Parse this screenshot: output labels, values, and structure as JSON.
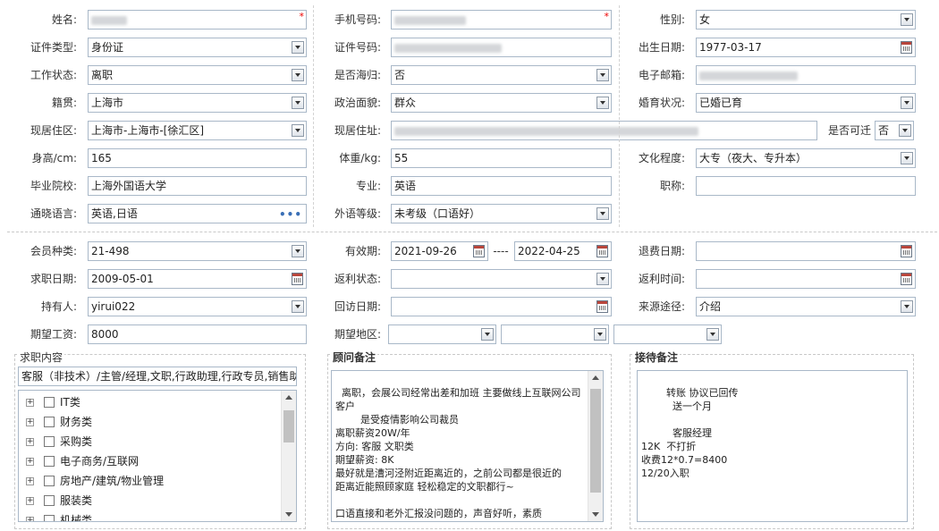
{
  "personal": {
    "name_label": "姓名:",
    "name_value": "",
    "phone_label": "手机号码:",
    "phone_value": "",
    "gender_label": "性别:",
    "gender_value": "女",
    "id_type_label": "证件类型:",
    "id_type_value": "身份证",
    "id_no_label": "证件号码:",
    "id_no_value": "",
    "birth_label": "出生日期:",
    "birth_value": "1977-03-17",
    "work_status_label": "工作状态:",
    "work_status_value": "离职",
    "overseas_label": "是否海归:",
    "overseas_value": "否",
    "email_label": "电子邮箱:",
    "email_value": "",
    "native_label": "籍贯:",
    "native_value": "上海市",
    "political_label": "政治面貌:",
    "political_value": "群众",
    "marital_label": "婚育状况:",
    "marital_value": "已婚已育",
    "district_label": "现居住区:",
    "district_value": "上海市-上海市-[徐汇区]",
    "address_label": "现居住址:",
    "address_value": "",
    "relocate_label": "是否可迁",
    "relocate_value": "否",
    "height_label": "身高/cm:",
    "height_value": "165",
    "weight_label": "体重/kg:",
    "weight_value": "55",
    "education_label": "文化程度:",
    "education_value": "大专（夜大、专升本）",
    "school_label": "毕业院校:",
    "school_value": "上海外国语大学",
    "major_label": "专业:",
    "major_value": "英语",
    "title_label": "职称:",
    "title_value": "",
    "language_label": "通晓语言:",
    "language_value": "英语,日语",
    "foreign_level_label": "外语等级:",
    "foreign_level_value": "未考级（口语好）"
  },
  "membership": {
    "type_label": "会员种类:",
    "type_value": "21-498",
    "valid_label": "有效期:",
    "valid_from": "2021-09-26",
    "valid_sep": "----",
    "valid_to": "2022-04-25",
    "refund_date_label": "退费日期:",
    "refund_date_value": "",
    "job_date_label": "求职日期:",
    "job_date_value": "2009-05-01",
    "rebate_status_label": "返利状态:",
    "rebate_status_value": "",
    "rebate_time_label": "返利时间:",
    "rebate_time_value": "",
    "holder_label": "持有人:",
    "holder_value": "yirui022",
    "visit_date_label": "回访日期:",
    "visit_date_value": "",
    "source_label": "来源途径:",
    "source_value": "介绍",
    "salary_label": "期望工资:",
    "salary_value": "8000",
    "region_label": "期望地区:",
    "region_values": [
      "",
      "",
      ""
    ]
  },
  "job_panel": {
    "title": "求职内容",
    "summary": "客服（非技术）/主管/经理,文职,行政助理,行政专员,销售助",
    "categories": [
      "IT类",
      "财务类",
      "采购类",
      "电子商务/互联网",
      "房地产/建筑/物业管理",
      "服装类",
      "机械类"
    ]
  },
  "consultant_panel": {
    "title": "顾问备注",
    "text": "离职，会展公司经常出差和加班 主要做线上互联网公司客户\n        是受疫情影响公司裁员\n离职薪资20W/年\n方向: 客服 文职类\n期望薪资: 8K\n最好就是漕河泾附近距离近的，之前公司都是很近的\n距离近能照顾家庭 轻松稳定的文职都行~\n\n口语直接和老外汇报没问题的，声音好听，素质"
  },
  "reception_panel": {
    "title": "接待备注",
    "text": "      转账 协议已回传\n          送一个月\n\n          客服经理\n12K  不打折\n收费12*0.7=8400\n12/20入职"
  },
  "colors": {
    "border": "#a9b8c8",
    "required": "#ee0000",
    "link_dots": "#3a6fb6"
  }
}
